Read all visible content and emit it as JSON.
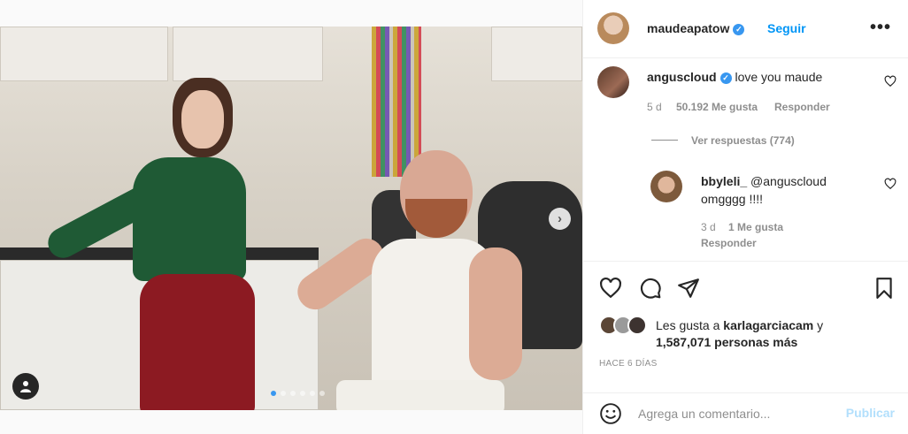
{
  "post": {
    "slide_count": 6,
    "active_slide": 1
  },
  "header": {
    "username": "maudeapatow",
    "verified": true,
    "follow_label": "Seguir",
    "more_label": "•••"
  },
  "comments": [
    {
      "username": "anguscloud",
      "verified": true,
      "text": "love you maude",
      "age": "5 d",
      "likes": "50.192 Me gusta",
      "reply_label": "Responder",
      "view_replies": "Ver respuestas (774)"
    },
    {
      "username": "bbyleli_",
      "mention": "@anguscloud",
      "text": "omgggg !!!!",
      "age": "3 d",
      "likes": "1 Me gusta",
      "reply_label": "Responder"
    }
  ],
  "likes": {
    "prefix": "Les gusta a ",
    "user": "karlagarciacam",
    "middle": " y",
    "others": "1,587,071 personas más"
  },
  "date": "HACE 6 DÍAS",
  "add_comment": {
    "placeholder": "Agrega un comentario...",
    "publish_label": "Publicar"
  },
  "colors": {
    "accent": "#0095f6",
    "verified": "#3897f0",
    "publish_disabled": "#b2dffc"
  },
  "icons": [
    "user-tag-icon",
    "chevron-right-icon",
    "verified-icon",
    "more-icon",
    "heart-icon",
    "comment-icon",
    "share-icon",
    "bookmark-icon",
    "emoji-icon"
  ]
}
